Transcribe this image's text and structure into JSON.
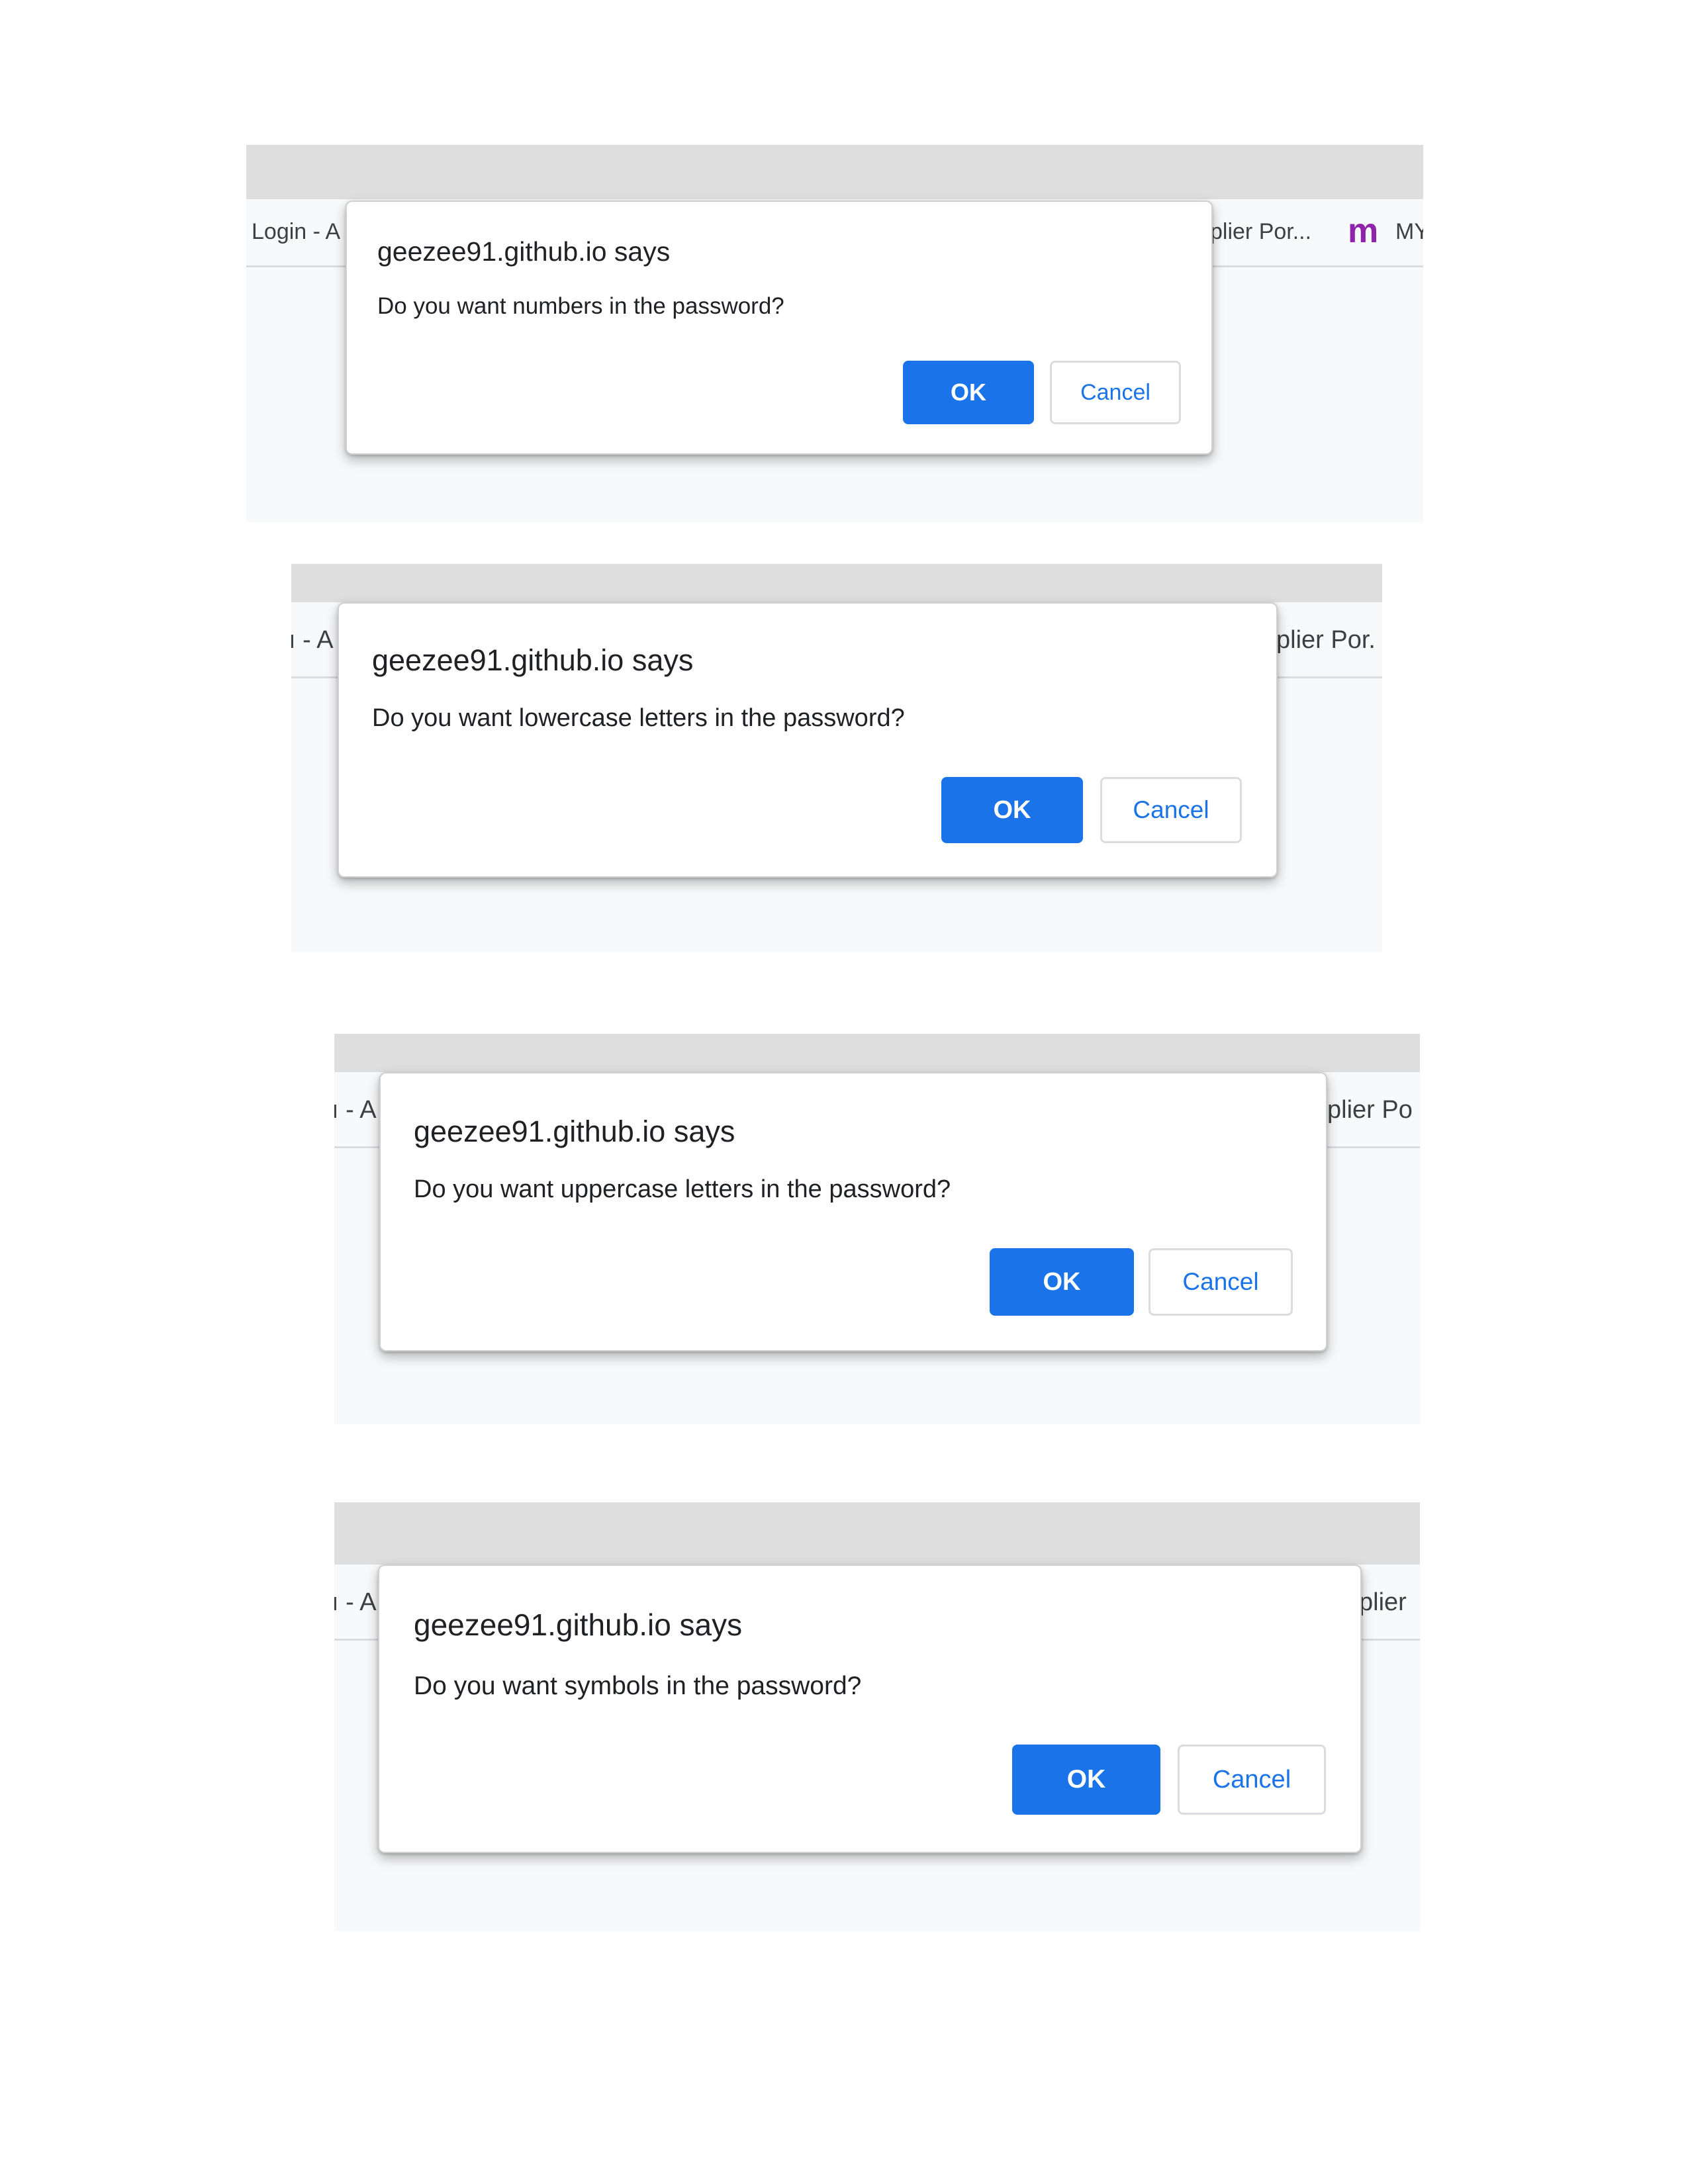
{
  "screenshots": [
    {
      "bookmark_left": "Login - A",
      "bookmark_right": "plier Por...",
      "bookmark_extra_icon": "m",
      "bookmark_extra_label": "MY",
      "dialog": {
        "title": "geezee91.github.io says",
        "message": "Do you want numbers in the password?",
        "ok_label": "OK",
        "cancel_label": "Cancel"
      }
    },
    {
      "bookmark_left": "ı - A",
      "bookmark_right": "plier Por.",
      "dialog": {
        "title": "geezee91.github.io says",
        "message": "Do you want lowercase letters in the password?",
        "ok_label": "OK",
        "cancel_label": "Cancel"
      }
    },
    {
      "bookmark_left": "ı - A",
      "bookmark_right": "plier Po",
      "dialog": {
        "title": "geezee91.github.io says",
        "message": "Do you want uppercase letters in the password?",
        "ok_label": "OK",
        "cancel_label": "Cancel"
      }
    },
    {
      "bookmark_left": "ı - A",
      "bookmark_right": "plier",
      "dialog": {
        "title": "geezee91.github.io says",
        "message": "Do you want symbols in the password?",
        "ok_label": "OK",
        "cancel_label": "Cancel"
      }
    }
  ],
  "colors": {
    "ok_button": "#1a73e8",
    "cancel_text": "#1a73e8",
    "tab_strip": "#dedede",
    "page_bg": "#f8f9fa",
    "bookmark_m_icon": "#8e24aa"
  }
}
